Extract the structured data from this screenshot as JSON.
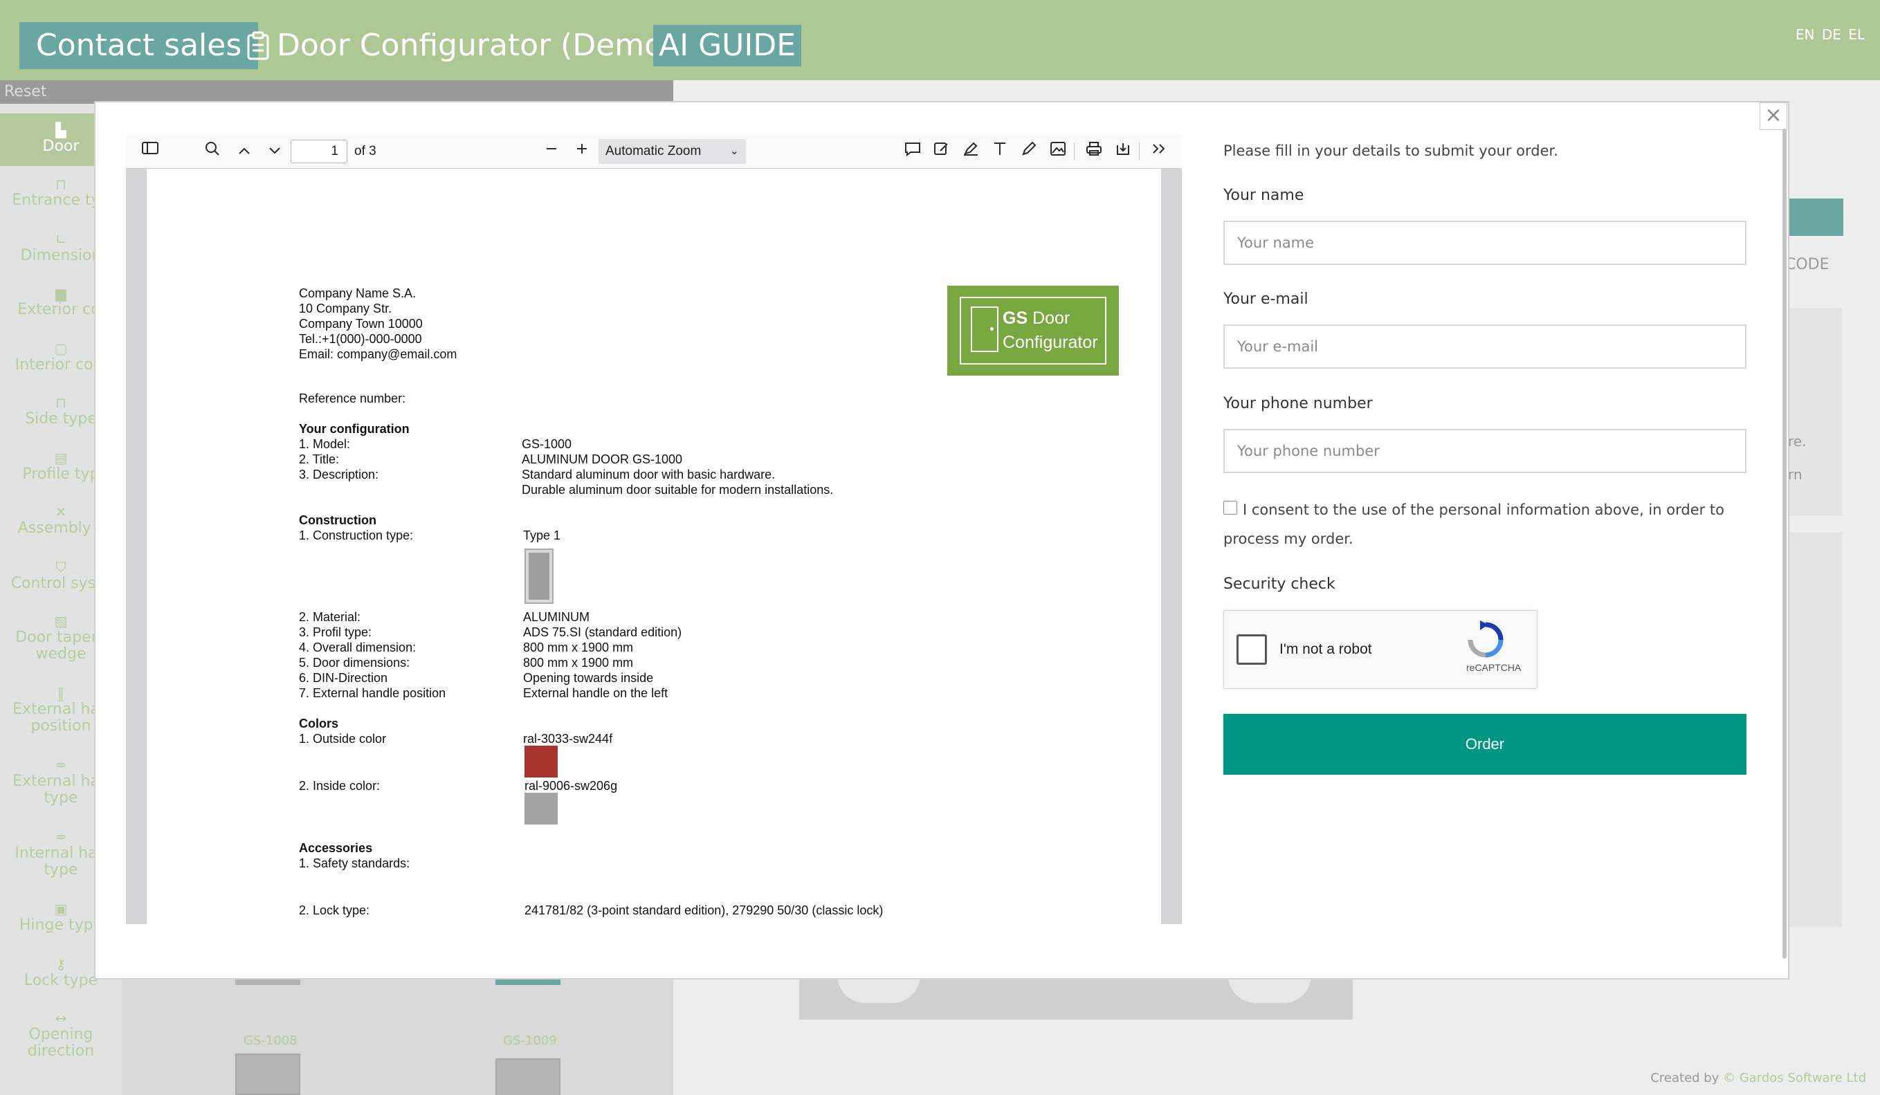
{
  "header": {
    "contact_label": "Contact sales",
    "title": "Door Configurator (Demo)",
    "ai_guide_label": "AI GUIDE",
    "languages": [
      "EN",
      "DE",
      "EL"
    ]
  },
  "toolbar": {
    "reset_label": "Reset"
  },
  "sidebar": {
    "items": [
      {
        "label": "Door",
        "icon": "door-icon"
      },
      {
        "label": "Entrance typ",
        "icon": "entrance-icon"
      },
      {
        "label": "Dimension",
        "icon": "ruler-icon"
      },
      {
        "label": "Exterior col",
        "icon": "paint-icon"
      },
      {
        "label": "Interior colo",
        "icon": "paint-icon"
      },
      {
        "label": "Side type",
        "icon": "side-icon"
      },
      {
        "label": "Profile typ",
        "icon": "profile-icon"
      },
      {
        "label": "Assembly s",
        "icon": "tools-icon"
      },
      {
        "label": "Control syste",
        "icon": "shield-icon"
      },
      {
        "label": "Door tapere wedge",
        "icon": "wedge-icon"
      },
      {
        "label": "External han position",
        "icon": "handle-icon"
      },
      {
        "label": "External han type",
        "icon": "handle-icon"
      },
      {
        "label": "Internal han type",
        "icon": "handle-icon"
      },
      {
        "label": "Hinge type",
        "icon": "hinge-icon"
      },
      {
        "label": "Lock type",
        "icon": "key-icon"
      },
      {
        "label": "Opening direction",
        "icon": "arrows-icon"
      }
    ]
  },
  "gallery": {
    "items": [
      "GS-1008",
      "GS-1009"
    ]
  },
  "right_panel": {
    "code_label": "CODE",
    "text_1": "re.",
    "text_2": "rn"
  },
  "footer": {
    "credit_prefix": "Created by ",
    "credit_link": "© Gardos Software Ltd"
  },
  "pdf_viewer": {
    "page_number": "1",
    "page_count_label": "of 3",
    "zoom": "Automatic Zoom",
    "document": {
      "company": {
        "name": "Company Name S.A.",
        "street": "10 Company Str.",
        "town": "Company Town 10000",
        "tel": "Tel.:+1(000)-000-0000",
        "email": "Email: company@email.com"
      },
      "logo": {
        "line1_bold": "GS",
        "line1_rest": " Door",
        "line2": "Configurator"
      },
      "reference_label": "Reference number:",
      "configuration": {
        "heading": "Your configuration",
        "rows": [
          {
            "label": "1. Model:",
            "value": "GS-1000"
          },
          {
            "label": "2. Title:",
            "value": "ALUMINUM DOOR GS-1000"
          },
          {
            "label": "3. Description:",
            "value": "Standard aluminum door with basic hardware."
          },
          {
            "label": "",
            "value": "Durable aluminum door suitable for modern installations."
          }
        ]
      },
      "construction": {
        "heading": "Construction",
        "type_label": "1. Construction type:",
        "type_value": "Type 1",
        "rows": [
          {
            "label": "2. Material:",
            "value": "ALUMINUM"
          },
          {
            "label": "3. Profil type:",
            "value": "ADS 75.SI (standard edition)"
          },
          {
            "label": "4. Overall dimension:",
            "value": "800 mm x 1900 mm"
          },
          {
            "label": "5. Door dimensions:",
            "value": "800 mm x 1900 mm"
          },
          {
            "label": "6. DIN-Direction",
            "value": "Opening towards inside"
          },
          {
            "label": "7. External handle position",
            "value": "External handle on the left"
          }
        ]
      },
      "colors": {
        "heading": "Colors",
        "outside_label": "1. Outside color",
        "outside_value": "ral-3033-sw244f",
        "outside_hex": "#a5342e",
        "inside_label": "2. Inside color:",
        "inside_value": "ral-9006-sw206g",
        "inside_hex": "#a4a4a4"
      },
      "accessories": {
        "heading": "Accessories",
        "safety_label": "1. Safety standards:",
        "lock_label": "2. Lock type:",
        "lock_value": "241781/82 (3-point standard edition), 279290 50/30 (classic lock)"
      }
    }
  },
  "order_form": {
    "intro": "Please fill in your details to submit your order.",
    "name_label": "Your name",
    "name_placeholder": "Your name",
    "email_label": "Your e-mail",
    "email_placeholder": "Your e-mail",
    "phone_label": "Your phone number",
    "phone_placeholder": "Your phone number",
    "consent_text": "I consent to the use of the personal information above, in order to process my order.",
    "security_label": "Security check",
    "recaptcha_text": "I'm not a robot",
    "recaptcha_brand": "reCAPTCHA",
    "order_label": "Order"
  },
  "colors": {
    "header_bg": "#aec895",
    "accent_teal": "#6aa7a3",
    "order_button": "#009684",
    "logo_green": "#78a63f"
  }
}
